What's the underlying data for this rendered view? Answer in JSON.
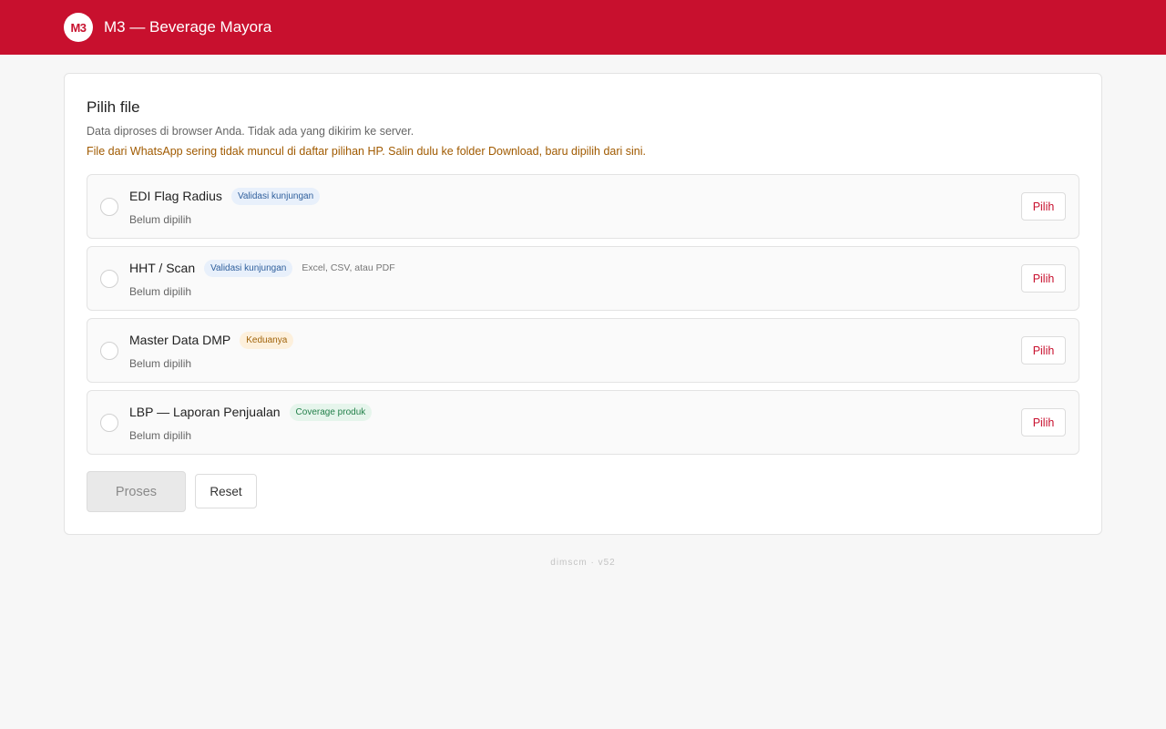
{
  "header": {
    "logo_text": "M3",
    "title": "M3 — Beverage Mayora"
  },
  "card": {
    "title": "Pilih file",
    "subtitle": "Data diproses di browser Anda. Tidak ada yang dikirim ke server.",
    "warning": "File dari WhatsApp sering tidak muncul di daftar pilihan HP. Salin dulu ke folder Download, baru dipilih dari sini."
  },
  "files": [
    {
      "name": "EDI Flag Radius",
      "tag": "Validasi kunjungan",
      "tag_color": "#e8f0fb",
      "hint": "",
      "status": "Belum dipilih",
      "button": "Pilih"
    },
    {
      "name": "HHT / Scan",
      "tag": "Validasi kunjungan",
      "tag_color": "#e8f0fb",
      "hint": "Excel, CSV, atau PDF",
      "status": "Belum dipilih",
      "button": "Pilih"
    },
    {
      "name": "Master Data DMP",
      "tag": "Keduanya",
      "tag_color": "#fdf0dc",
      "hint": "",
      "status": "Belum dipilih",
      "button": "Pilih"
    },
    {
      "name": "LBP — Laporan Penjualan",
      "tag": "Coverage produk",
      "tag_color": "#e6f5ec",
      "hint": "",
      "status": "Belum dipilih",
      "button": "Pilih"
    }
  ],
  "actions": {
    "process_label": "Proses",
    "reset_label": "Reset"
  },
  "footer": {
    "text": "dimscm · v52"
  },
  "colors": {
    "brand": "#c8102e",
    "warning_text": "#a05a00"
  }
}
